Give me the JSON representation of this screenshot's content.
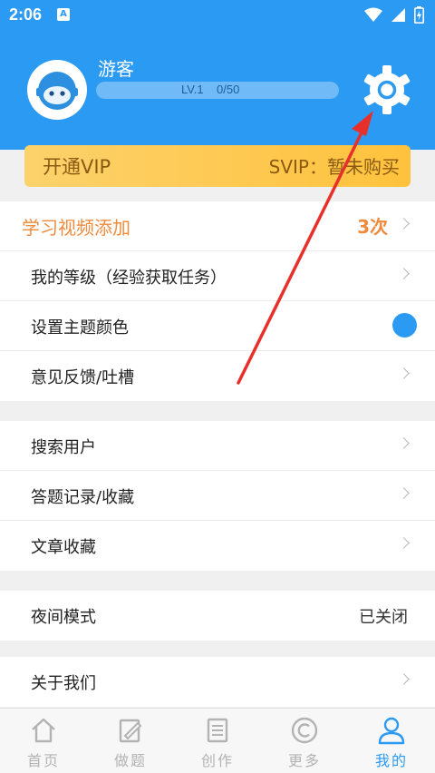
{
  "status_bar": {
    "time": "2:06",
    "notification_badge": "A"
  },
  "profile": {
    "username": "游客",
    "level_text": "LV.1    0/50",
    "progress": 0.0
  },
  "vip": {
    "left_label": "开通VIP",
    "right_label": "SVIP：暂未购买"
  },
  "section1": [
    {
      "label": "学习视频添加",
      "value": "3次",
      "style": "highlight"
    },
    {
      "label": "我的等级（经验获取任务）"
    },
    {
      "label": "设置主题颜色",
      "theme_color": "#2b9af3"
    },
    {
      "label": "意见反馈/吐槽"
    }
  ],
  "section2": [
    {
      "label": "搜索用户"
    },
    {
      "label": "答题记录/收藏"
    },
    {
      "label": "文章收藏"
    }
  ],
  "section3": [
    {
      "label": "夜间模式",
      "value": "已关闭"
    }
  ],
  "section4": [
    {
      "label": "关于我们"
    }
  ],
  "tabs": [
    {
      "label": "首页",
      "icon": "home-icon"
    },
    {
      "label": "做题",
      "icon": "edit-icon"
    },
    {
      "label": "创作",
      "icon": "document-icon"
    },
    {
      "label": "更多",
      "icon": "copyright-icon"
    },
    {
      "label": "我的",
      "icon": "user-icon",
      "active": true
    }
  ],
  "colors": {
    "primary": "#2b9af3",
    "accent": "#f08a3c",
    "annotation": "#e8302a",
    "vip": "#ffc23d"
  }
}
